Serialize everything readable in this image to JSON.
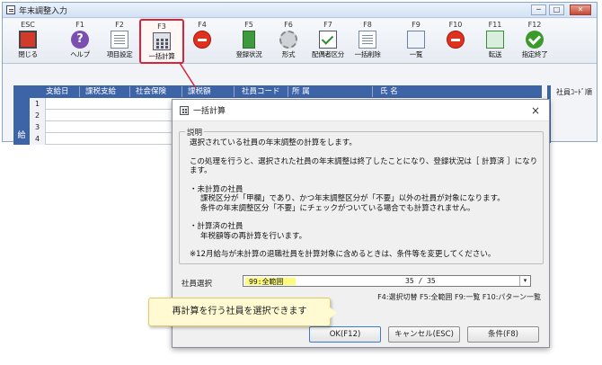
{
  "window": {
    "title": "年末調整入力"
  },
  "toolbar": [
    {
      "key": "ESC",
      "label": "閉じる",
      "icon": "exit-icon"
    },
    {
      "key": "F1",
      "label": "ヘルプ",
      "icon": "help-icon"
    },
    {
      "key": "F2",
      "label": "項目設定",
      "icon": "settings-sheet-icon"
    },
    {
      "key": "F3",
      "label": "一括計算",
      "icon": "calculator-icon"
    },
    {
      "key": "F4",
      "label": "",
      "icon": "no-entry-icon"
    },
    {
      "key": "F5",
      "label": "登録状況",
      "icon": "book-icon"
    },
    {
      "key": "F6",
      "label": "形式",
      "icon": "gear-icon"
    },
    {
      "key": "F7",
      "label": "配偶者区分",
      "icon": "checklist-icon"
    },
    {
      "key": "F8",
      "label": "一括削除",
      "icon": "delete-sheet-icon"
    },
    {
      "key": "F9",
      "label": "一覧",
      "icon": "list-icon"
    },
    {
      "key": "F10",
      "label": "",
      "icon": "no-entry-icon"
    },
    {
      "key": "F11",
      "label": "転送",
      "icon": "transfer-icon"
    },
    {
      "key": "F12",
      "label": "指定終了",
      "icon": "ok-icon"
    }
  ],
  "grid": {
    "headers": [
      "支給日",
      "課税支給",
      "社会保険",
      "課税額",
      "社員コード",
      "所 属",
      "氏 名"
    ],
    "rows": [
      "1",
      "2",
      "3",
      "4"
    ],
    "side_label": "給",
    "right_label": "社員ｺｰﾄﾞ順"
  },
  "dialog": {
    "title": "一括計算",
    "close": "×",
    "legend": "説明",
    "lines": [
      "選択されている社員の年末調整の計算をします。",
      "この処理を行うと、選択された社員の年末調整は終了したことになり、登録状況は［ 計算済 ］になります。",
      "・未計算の社員",
      "課税区分が「甲欄」であり、かつ年末調整区分が「不要」以外の社員が対象になります。",
      "条件の年末調整区分「不要」にチェックがついている場合でも計算されません。",
      "・計算済の社員",
      "年税額等の再計算を行います。",
      "※12月給与が未計算の退職社員を計算対象に含めるときは、条件等を変更してください。"
    ],
    "select_label": "社員選択",
    "select_value": "99:全範囲",
    "select_count": "35 / 35",
    "fkeys": "F4:選択切替 F5:全範囲 F9:一覧 F10:パターン一覧",
    "buttons": {
      "ok": "OK(F12)",
      "cancel": "キャンセル(ESC)",
      "condition": "条件(F8)"
    }
  },
  "callout": {
    "text": "再計算を行う社員を選択できます"
  },
  "colors": {
    "highlight": "#d9233b",
    "header_blue": "#3e64a8",
    "select_yellow": "#fffb7a"
  }
}
